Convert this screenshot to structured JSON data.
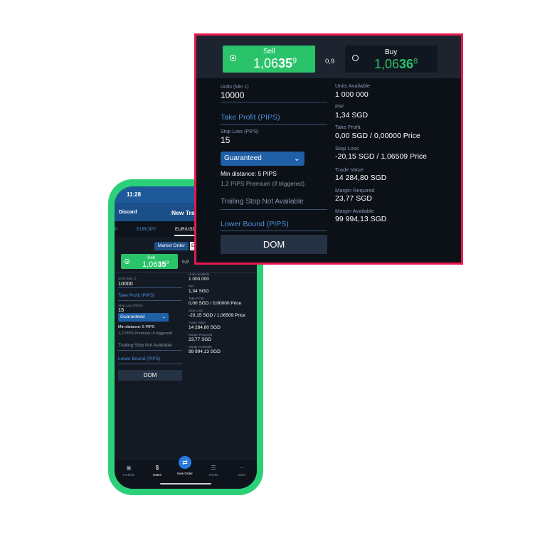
{
  "phone": {
    "status_time": "11:28",
    "header": {
      "discard": "Discard",
      "title": "New Tra"
    },
    "tabs": [
      {
        "label": "P"
      },
      {
        "label": "EUR/JPY"
      },
      {
        "label": "EUR/USD"
      }
    ],
    "order_type": {
      "market": "Market Order",
      "entry": "En"
    },
    "sell": {
      "label": "Sell",
      "price_prefix": "1,06",
      "price_big": "35",
      "price_sup": "9"
    },
    "spread": "0,9",
    "form": {
      "units_label": "Units (Min 1)",
      "units_value": "10000",
      "take_profit": "Take Profit (PIPS)",
      "stop_loss_label": "Stop Loss (PIPS)",
      "stop_loss_value": "15",
      "guaranteed": "Guaranteed",
      "min_distance": "Min distance: 5 PIPS",
      "premium": "1,2 PIPS Premium (if triggered)",
      "trailing": "Trailing Stop Not Available",
      "lower_bound": "Lower Bound (PIPS)",
      "dom": "DOM"
    },
    "info": [
      {
        "label": "Units Available",
        "value": "1 000 000"
      },
      {
        "label": "PIP",
        "value": "1,34 SGD"
      },
      {
        "label": "Take Profit",
        "value": "0,00 SGD / 0,00000 Price"
      },
      {
        "label": "Stop Loss",
        "value": "-20,15 SGD / 1,06509 Price"
      },
      {
        "label": "Trade Value",
        "value": "14 284,80 SGD"
      },
      {
        "label": "Margin Required",
        "value": "23,77 SGD"
      },
      {
        "label": "Margin Available",
        "value": "99 994,13 SGD"
      }
    ],
    "nav": [
      {
        "label": "Portfolio",
        "icon": "briefcase-icon"
      },
      {
        "label": "Rates",
        "icon": "rates-icon"
      },
      {
        "label": "New Order",
        "icon": "new-order-icon"
      },
      {
        "label": "Feeds",
        "icon": "feeds-icon"
      },
      {
        "label": "More",
        "icon": "more-icon"
      }
    ]
  },
  "zoom": {
    "sell": {
      "label": "Sell",
      "price_prefix": "1,06",
      "price_big": "35",
      "price_sup": "9"
    },
    "spread": "0,9",
    "buy": {
      "label": "Buy",
      "price_prefix": "1,06",
      "price_big": "36",
      "price_sup": "8"
    },
    "form": {
      "units_label": "Units (Min 1)",
      "units_value": "10000",
      "take_profit": "Take Profit (PIPS)",
      "stop_loss_label": "Stop Loss (PIPS)",
      "stop_loss_value": "15",
      "guaranteed": "Guaranteed",
      "min_distance": "Min distance: 5 PIPS",
      "premium": "1,2 PIPS Premium (if triggered)",
      "trailing": "Trailing Stop Not Available",
      "lower_bound": "Lower Bound (PIPS)",
      "dom": "DOM"
    },
    "info": [
      {
        "label": "Units Available",
        "value": "1 000 000"
      },
      {
        "label": "PIP",
        "value": "1,34 SGD"
      },
      {
        "label": "Take Profit",
        "value": "0,00 SGD / 0,00000 Price"
      },
      {
        "label": "Stop Loss",
        "value": "-20,15 SGD / 1,06509 Price"
      },
      {
        "label": "Trade Value",
        "value": "14 284,80 SGD"
      },
      {
        "label": "Margin Required",
        "value": "23,77 SGD"
      },
      {
        "label": "Margin Available",
        "value": "99 994,13 SGD"
      }
    ]
  },
  "colors": {
    "phone_frame": "#2bd079",
    "sell_green": "#2bc36a",
    "highlight_border": "#e8194f",
    "link_blue": "#4a90d9",
    "header_blue": "#1b4f8a"
  }
}
